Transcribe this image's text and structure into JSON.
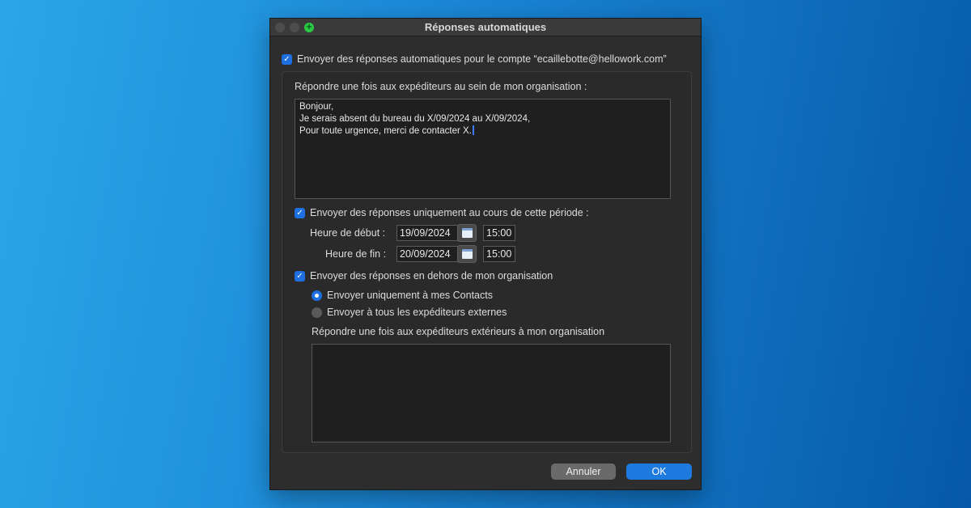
{
  "window": {
    "title": "Réponses automatiques"
  },
  "main": {
    "enable_auto_reply": {
      "checked": true,
      "label": "Envoyer des réponses automatiques pour le compte “ecaillebotte@hellowork.com”"
    },
    "internal": {
      "label": "Répondre une fois aux expéditeurs au sein de mon organisation :",
      "message_lines": [
        "Bonjour,",
        "Je serais absent du bureau du X/09/2024 au X/09/2024,",
        "Pour toute urgence, merci de contacter X."
      ]
    },
    "period": {
      "checked": true,
      "label": "Envoyer des réponses uniquement au cours de cette période :",
      "start_label": "Heure de début :",
      "start_date": "19/09/2024",
      "start_time": "15:00",
      "end_label": "Heure de fin :",
      "end_date": "20/09/2024",
      "end_time": "15:00"
    },
    "external": {
      "checked": true,
      "label": "Envoyer des réponses en dehors de mon organisation",
      "option_contacts": "Envoyer uniquement à mes Contacts",
      "option_all": "Envoyer à tous les expéditeurs externes",
      "selected": "contacts",
      "reply_label": "Répondre une fois aux expéditeurs extérieurs à mon organisation",
      "message": ""
    }
  },
  "buttons": {
    "cancel": "Annuler",
    "ok": "OK"
  },
  "colors": {
    "accent": "#1e6fe0",
    "background_start": "#2aa6e8",
    "background_end": "#0659a8"
  },
  "icons": {
    "checkbox": "checkmark",
    "calendar": "calendar-icon"
  }
}
